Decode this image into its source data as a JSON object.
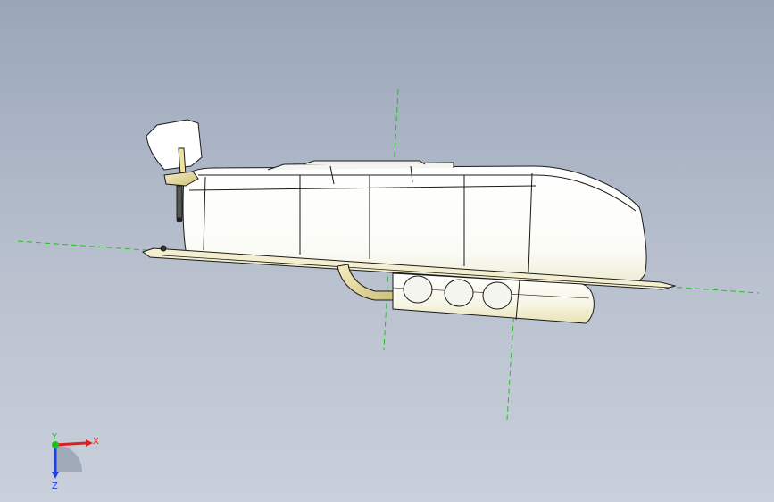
{
  "viewport": {
    "background_top": "#9aa6b8",
    "background_bottom": "#c9d0dc",
    "construction_line_color": "#22c022",
    "model_outline_color": "#1a1a1a",
    "body_fill": "#ffffff",
    "accent_fill": "#f1e9b8"
  },
  "triad": {
    "x_label": "X",
    "y_label": "Y",
    "z_label": "Z",
    "x_color": "#e02020",
    "y_color": "#20c020",
    "z_color": "#2040e0"
  }
}
